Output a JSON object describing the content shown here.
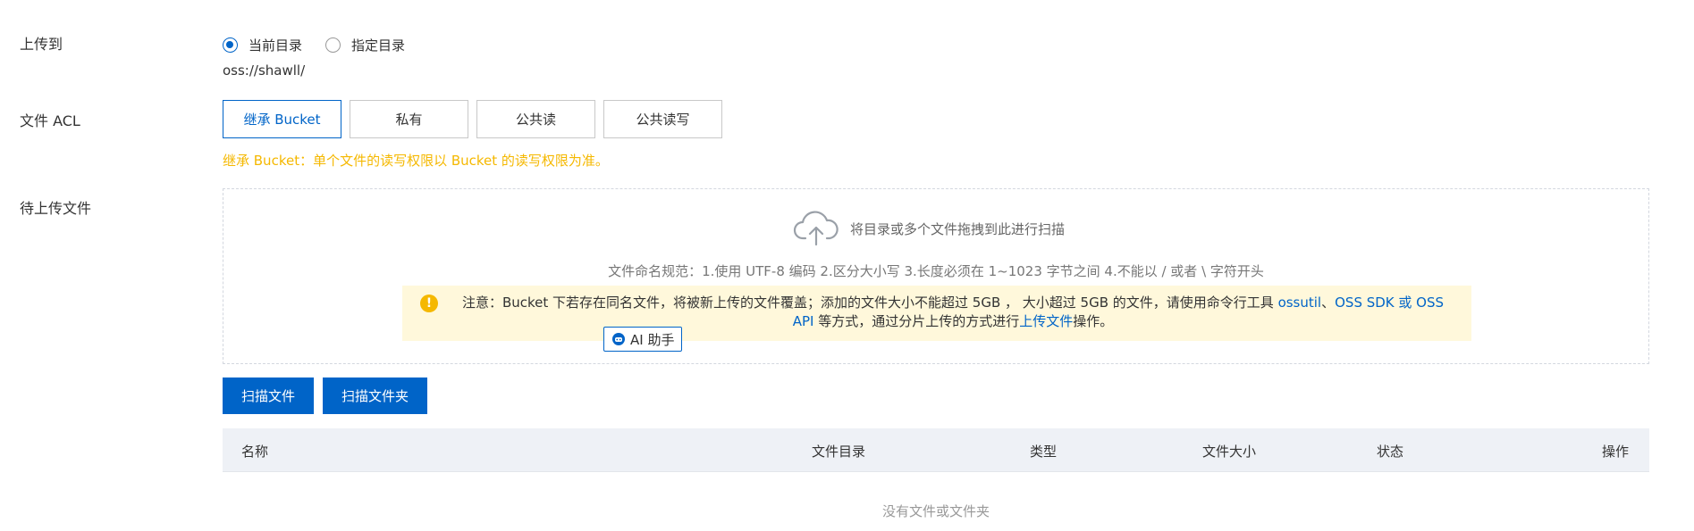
{
  "labels": {
    "upload_to": "上传到",
    "file_acl": "文件 ACL",
    "pending_files": "待上传文件"
  },
  "upload_target": {
    "options": [
      "当前目录",
      "指定目录"
    ],
    "selected": "当前目录",
    "path": "oss://shawll/"
  },
  "acl": {
    "options": [
      "继承 Bucket",
      "私有",
      "公共读",
      "公共读写"
    ],
    "selected": "继承 Bucket",
    "hint": "继承 Bucket：单个文件的读写权限以 Bucket 的读写权限为准。"
  },
  "dropzone": {
    "title": "将目录或多个文件拖拽到此进行扫描",
    "naming_rule": "文件命名规范：1.使用 UTF-8 编码 2.区分大小写 3.长度必须在 1~1023 字节之间 4.不能以 / 或者 \\ 字符开头",
    "notice": {
      "part1": "注意：Bucket 下若存在同名文件，将被新上传的文件覆盖；添加的文件大小不能超过 5GB ， 大小超过 5GB 的文件，请使用命令行工具 ",
      "link1": "ossutil",
      "sep": "、",
      "link2": "OSS SDK 或 OSS API",
      "part2": " 等方式，通过分片上传的方式进行",
      "link3": "上传文件",
      "part3": "操作。"
    },
    "ai_button": "AI 助手"
  },
  "buttons": {
    "scan_files": "扫描文件",
    "scan_folder": "扫描文件夹"
  },
  "table": {
    "columns": [
      "名称",
      "文件目录",
      "类型",
      "文件大小",
      "状态",
      "操作"
    ],
    "empty_text": "没有文件或文件夹"
  },
  "colors": {
    "primary": "#0064c8",
    "warning": "#f5b800",
    "notice_bg": "#fff8db"
  }
}
